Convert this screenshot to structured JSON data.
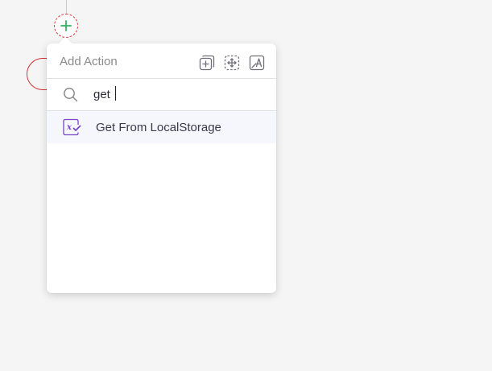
{
  "popup": {
    "title": "Add Action",
    "header_icons": [
      "add-block-icon",
      "select-move-icon",
      "text-image-icon"
    ]
  },
  "search": {
    "value": "get",
    "icon": "search-icon"
  },
  "results": [
    {
      "label": "Get From LocalStorage",
      "icon": "variable-function-icon"
    }
  ],
  "colors": {
    "accent_green": "#2bb55a",
    "node_red": "#d62f2f",
    "result_icon_purple": "#7a45c9",
    "result_highlight": "#f6f6fd"
  }
}
